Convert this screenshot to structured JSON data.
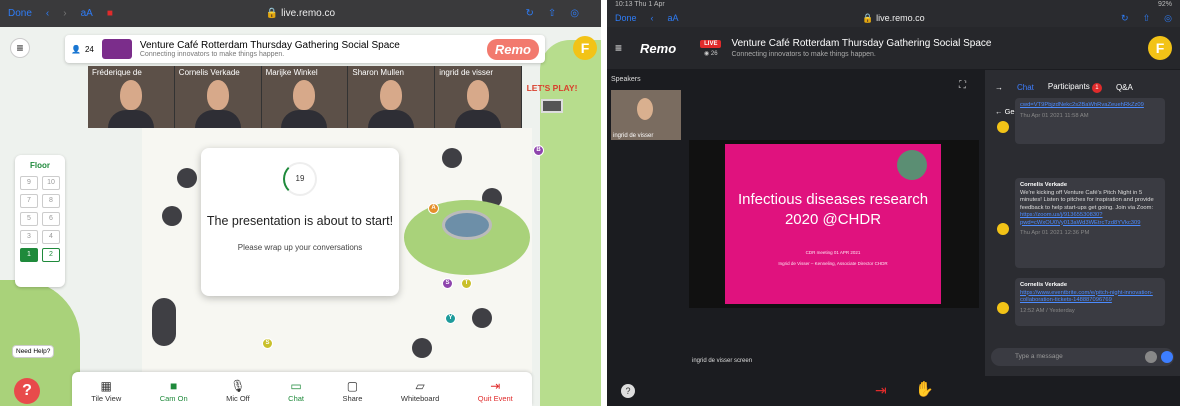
{
  "left": {
    "safari": {
      "done": "Done",
      "aa": "aA",
      "url": "live.remo.co"
    },
    "header": {
      "count": "24",
      "title": "Venture Café Rotterdam Thursday Gathering Social Space",
      "subtitle": "Connecting innovators to make things happen.",
      "brand": "Remo",
      "avatar": "F"
    },
    "participants": [
      "Fréderique de",
      "Cornelis Verkade",
      "Marijke Winkel",
      "Sharon Mullen",
      "ingrid de visser"
    ],
    "floor": {
      "title": "Floor",
      "rows": [
        [
          "9",
          "10"
        ],
        [
          "7",
          "8"
        ],
        [
          "5",
          "6"
        ],
        [
          "3",
          "4"
        ],
        [
          "1",
          "2"
        ]
      ]
    },
    "presentation": {
      "countdown": "19",
      "heading": "The presentation is about to start!",
      "message": "Please wrap up your conversations"
    },
    "lets_play": "LET'S PLAY!",
    "help": {
      "label": "Need Help?"
    },
    "toolbar": [
      {
        "label": "Tile View",
        "icon": "▦",
        "color": "#333"
      },
      {
        "label": "Cam On",
        "icon": "■",
        "color": "#1f8a3b"
      },
      {
        "label": "Mic Off",
        "icon": "🎙",
        "color": "#333"
      },
      {
        "label": "Chat",
        "icon": "▭",
        "color": "#1f8a3b"
      },
      {
        "label": "Share",
        "icon": "▢",
        "color": "#333"
      },
      {
        "label": "Whiteboard",
        "icon": "▱",
        "color": "#333"
      },
      {
        "label": "Quit Event",
        "icon": "⇥",
        "color": "#e02b2b"
      }
    ]
  },
  "right": {
    "status": {
      "time": "10:13",
      "day": "Thu 1 Apr",
      "battery": "92%"
    },
    "safari": {
      "done": "Done",
      "aa": "aA",
      "url": "live.remo.co"
    },
    "header": {
      "live": "LIVE",
      "count": "26",
      "title": "Venture Café Rotterdam Thursday Gathering Social Space",
      "subtitle": "Connecting innovators to make things happen.",
      "brand": "Remo",
      "avatar": "F"
    },
    "speakers_label": "Speakers",
    "speaker_name": "ingrid de visser",
    "slide": {
      "title": "Infectious diseases research 2020 @CHDR",
      "line1": "CDR meeting 01 APR 2021",
      "line2": "Ingrid de Visser – Kenneling, Associate Director CHDR"
    },
    "screen_label": "ingrid de visser screen",
    "chat": {
      "tabs": [
        "Chat",
        "Participants",
        "Q&A"
      ],
      "badge": "1",
      "general": "General Chat",
      "messages": [
        {
          "name": "",
          "text": "",
          "link": "cwd=VT9PbjzdNekc2s2BaWhRvaZeuehRkZz09",
          "time": "Thu Apr 01 2021 11:58 AM"
        },
        {
          "name": "Cornelis Verkade",
          "text": "We're kicking off Venture Café's Pitch Night in 5 minutes! Listen to pitches for inspiration and provide feedback to help start-ups get going. Join via Zoom:",
          "link": "https://zoom.us/j/91365530830?pwd=cWxOU0Vy013aWd3WEtrcTzd8YVkc309",
          "time": "Thu Apr 01 2021 12:36 PM"
        },
        {
          "name": "Cornelis Verkade",
          "text": "",
          "link": "https://www.eventbrite.com/e/pitch-night-innovation-collaboration-tickets-148887096769",
          "time": "12:52 AM / Yesterday"
        }
      ],
      "placeholder": "Type a message"
    }
  }
}
